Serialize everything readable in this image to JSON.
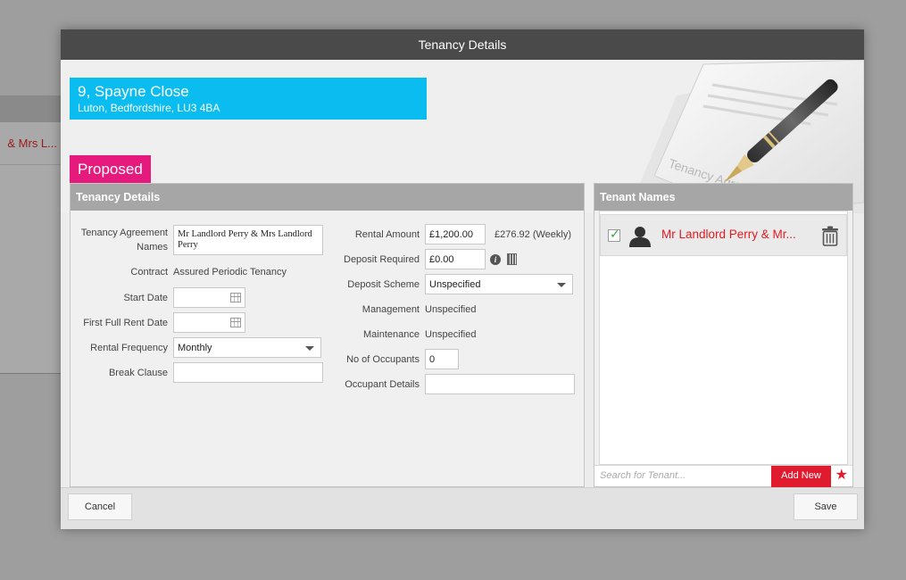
{
  "background": {
    "row_text": "& Mrs L..."
  },
  "modal": {
    "title": "Tenancy Details"
  },
  "property": {
    "address_line1": "9, Spayne Close",
    "address_line2": "Luton, Bedfordshire, LU3 4BA",
    "status": "Proposed",
    "image_caption": "Tenancy Agreement"
  },
  "details": {
    "header": "Tenancy Details",
    "agreement_names_label": "Tenancy Agreement Names",
    "agreement_names_value": "Mr Landlord Perry & Mrs Landlord Perry",
    "contract_label": "Contract",
    "contract_value": "Assured Periodic Tenancy",
    "start_date_label": "Start Date",
    "start_date_value": "",
    "first_rent_label": "First Full Rent Date",
    "first_rent_value": "",
    "rental_frequency_label": "Rental Frequency",
    "rental_frequency_value": "Monthly",
    "break_clause_label": "Break Clause",
    "break_clause_value": "",
    "rental_amount_label": "Rental Amount",
    "rental_amount_value": "£1,200.00",
    "rental_weekly": "£276.92 (Weekly)",
    "deposit_required_label": "Deposit Required",
    "deposit_required_value": "£0.00",
    "deposit_scheme_label": "Deposit Scheme",
    "deposit_scheme_value": "Unspecified",
    "management_label": "Management",
    "management_value": "Unspecified",
    "maintenance_label": "Maintenance",
    "maintenance_value": "Unspecified",
    "occupants_label": "No of Occupants",
    "occupants_value": "0",
    "occupant_details_label": "Occupant Details",
    "occupant_details_value": ""
  },
  "tenants": {
    "header": "Tenant Names",
    "items": [
      {
        "name": "Mr Landlord Perry & Mr...",
        "checked": true
      }
    ],
    "search_placeholder": "Search for Tenant...",
    "add_new_label": "Add New"
  },
  "footer": {
    "cancel_label": "Cancel",
    "save_label": "Save"
  },
  "colors": {
    "address_bg": "#0bbcf0",
    "status_bg": "#e6197c",
    "accent_red": "#e11b22",
    "title_bar": "#4a4a4a"
  },
  "icons": [
    "info-icon",
    "calculator-icon",
    "calendar-icon",
    "person-icon",
    "trash-icon",
    "star-icon",
    "checkmark-icon",
    "pen-icon"
  ]
}
